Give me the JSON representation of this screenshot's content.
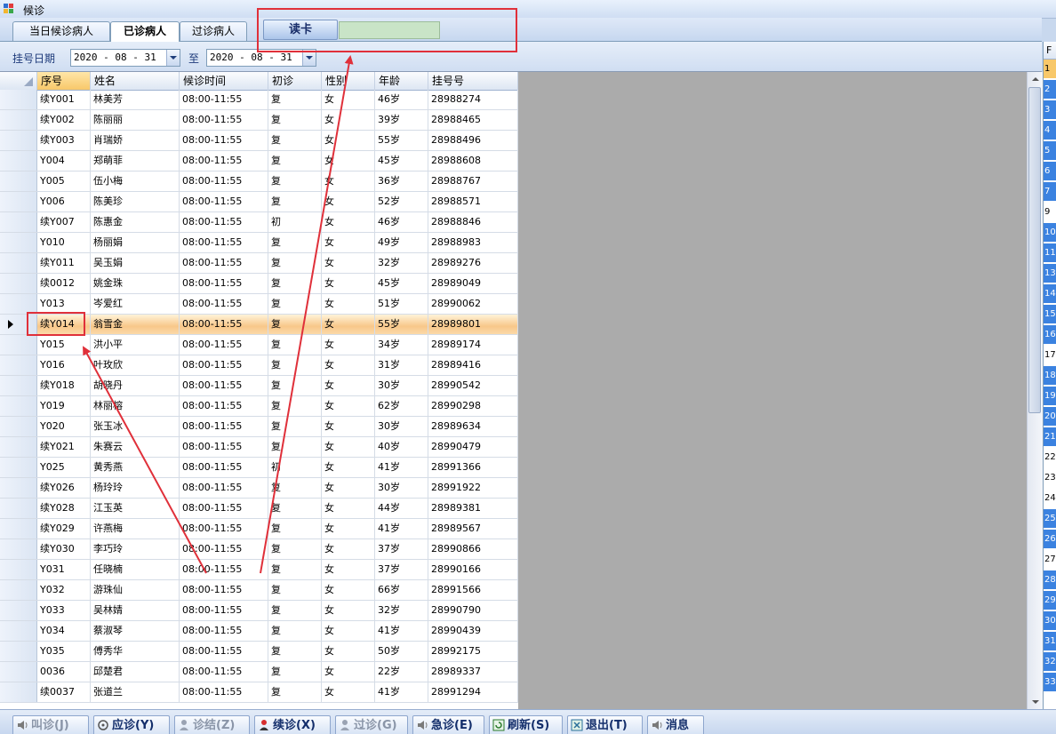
{
  "window": {
    "title": "候诊"
  },
  "tabs": [
    {
      "label": "当日候诊病人"
    },
    {
      "label": "已诊病人"
    },
    {
      "label": "过诊病人"
    }
  ],
  "read_card": {
    "label": "读卡",
    "value": ""
  },
  "date_filter": {
    "label": "挂号日期",
    "from": "2020 - 08 - 31",
    "to_label": "至",
    "to": "2020 - 08 - 31"
  },
  "grid": {
    "columns": [
      "序号",
      "姓名",
      "候诊时间",
      "初诊",
      "性别",
      "年龄",
      "挂号号"
    ],
    "rows": [
      [
        "续Y001",
        "林美芳",
        "08:00-11:55",
        "复",
        "女",
        "46岁",
        "28988274"
      ],
      [
        "续Y002",
        "陈丽丽",
        "08:00-11:55",
        "复",
        "女",
        "39岁",
        "28988465"
      ],
      [
        "续Y003",
        "肖瑞娇",
        "08:00-11:55",
        "复",
        "女",
        "55岁",
        "28988496"
      ],
      [
        "Y004",
        "郑萌菲",
        "08:00-11:55",
        "复",
        "女",
        "45岁",
        "28988608"
      ],
      [
        "Y005",
        "伍小梅",
        "08:00-11:55",
        "复",
        "女",
        "36岁",
        "28988767"
      ],
      [
        "Y006",
        "陈美珍",
        "08:00-11:55",
        "复",
        "女",
        "52岁",
        "28988571"
      ],
      [
        "续Y007",
        "陈惠金",
        "08:00-11:55",
        "初",
        "女",
        "46岁",
        "28988846"
      ],
      [
        "Y010",
        "杨丽娟",
        "08:00-11:55",
        "复",
        "女",
        "49岁",
        "28988983"
      ],
      [
        "续Y011",
        "吴玉娟",
        "08:00-11:55",
        "复",
        "女",
        "32岁",
        "28989276"
      ],
      [
        "续0012",
        "姚金珠",
        "08:00-11:55",
        "复",
        "女",
        "45岁",
        "28989049"
      ],
      [
        "Y013",
        "岑爱红",
        "08:00-11:55",
        "复",
        "女",
        "51岁",
        "28990062"
      ],
      [
        "续Y014",
        "翁雪金",
        "08:00-11:55",
        "复",
        "女",
        "55岁",
        "28989801"
      ],
      [
        "Y015",
        "洪小平",
        "08:00-11:55",
        "复",
        "女",
        "34岁",
        "28989174"
      ],
      [
        "Y016",
        "叶玫欣",
        "08:00-11:55",
        "复",
        "女",
        "31岁",
        "28989416"
      ],
      [
        "续Y018",
        "胡晓丹",
        "08:00-11:55",
        "复",
        "女",
        "30岁",
        "28990542"
      ],
      [
        "Y019",
        "林丽榕",
        "08:00-11:55",
        "复",
        "女",
        "62岁",
        "28990298"
      ],
      [
        "Y020",
        "张玉冰",
        "08:00-11:55",
        "复",
        "女",
        "30岁",
        "28989634"
      ],
      [
        "续Y021",
        "朱赛云",
        "08:00-11:55",
        "复",
        "女",
        "40岁",
        "28990479"
      ],
      [
        "Y025",
        "黄秀燕",
        "08:00-11:55",
        "初",
        "女",
        "41岁",
        "28991366"
      ],
      [
        "续Y026",
        "杨玲玲",
        "08:00-11:55",
        "复",
        "女",
        "30岁",
        "28991922"
      ],
      [
        "续Y028",
        "江玉英",
        "08:00-11:55",
        "复",
        "女",
        "44岁",
        "28989381"
      ],
      [
        "续Y029",
        "许燕梅",
        "08:00-11:55",
        "复",
        "女",
        "41岁",
        "28989567"
      ],
      [
        "续Y030",
        "李巧玲",
        "08:00-11:55",
        "复",
        "女",
        "37岁",
        "28990866"
      ],
      [
        "Y031",
        "任晓楠",
        "08:00-11:55",
        "复",
        "女",
        "37岁",
        "28990166"
      ],
      [
        "Y032",
        "游珠仙",
        "08:00-11:55",
        "复",
        "女",
        "66岁",
        "28991566"
      ],
      [
        "Y033",
        "吴林婧",
        "08:00-11:55",
        "复",
        "女",
        "32岁",
        "28990790"
      ],
      [
        "Y034",
        "蔡淑琴",
        "08:00-11:55",
        "复",
        "女",
        "41岁",
        "28990439"
      ],
      [
        "Y035",
        "傅秀华",
        "08:00-11:55",
        "复",
        "女",
        "50岁",
        "28992175"
      ],
      [
        "0036",
        "邱楚君",
        "08:00-11:55",
        "复",
        "女",
        "22岁",
        "28989337"
      ],
      [
        "续0037",
        "张道兰",
        "08:00-11:55",
        "复",
        "女",
        "41岁",
        "28991294"
      ]
    ],
    "current_row": 11
  },
  "right_panel": {
    "header": "F",
    "numbers": [
      "1",
      "2",
      "3",
      "4",
      "5",
      "6",
      "7",
      "9",
      "10",
      "11",
      "13",
      "14",
      "15",
      "16",
      "17",
      "18",
      "19",
      "20",
      "21",
      "22",
      "23",
      "24",
      "25",
      "26",
      "27",
      "28",
      "29",
      "30",
      "31",
      "32",
      "33"
    ]
  },
  "buttons": [
    {
      "label": "叫诊(J)",
      "enabled": false,
      "icon": "speaker-icon"
    },
    {
      "label": "应诊(Y)",
      "enabled": true,
      "icon": "stethoscope-icon"
    },
    {
      "label": "诊结(Z)",
      "enabled": false,
      "icon": "person-icon"
    },
    {
      "label": "续诊(X)",
      "enabled": true,
      "icon": "person-red-icon"
    },
    {
      "label": "过诊(G)",
      "enabled": false,
      "icon": "person-icon"
    },
    {
      "label": "急诊(E)",
      "enabled": true,
      "icon": "speaker-icon"
    },
    {
      "label": "刷新(S)",
      "enabled": true,
      "icon": "refresh-icon"
    },
    {
      "label": "退出(T)",
      "enabled": true,
      "icon": "exit-icon"
    },
    {
      "label": "消息",
      "enabled": true,
      "icon": "speaker-icon"
    }
  ],
  "colors": {
    "accent": "#f8c86a",
    "annotation": "#e0303a",
    "card_field": "#c9e4c7"
  }
}
